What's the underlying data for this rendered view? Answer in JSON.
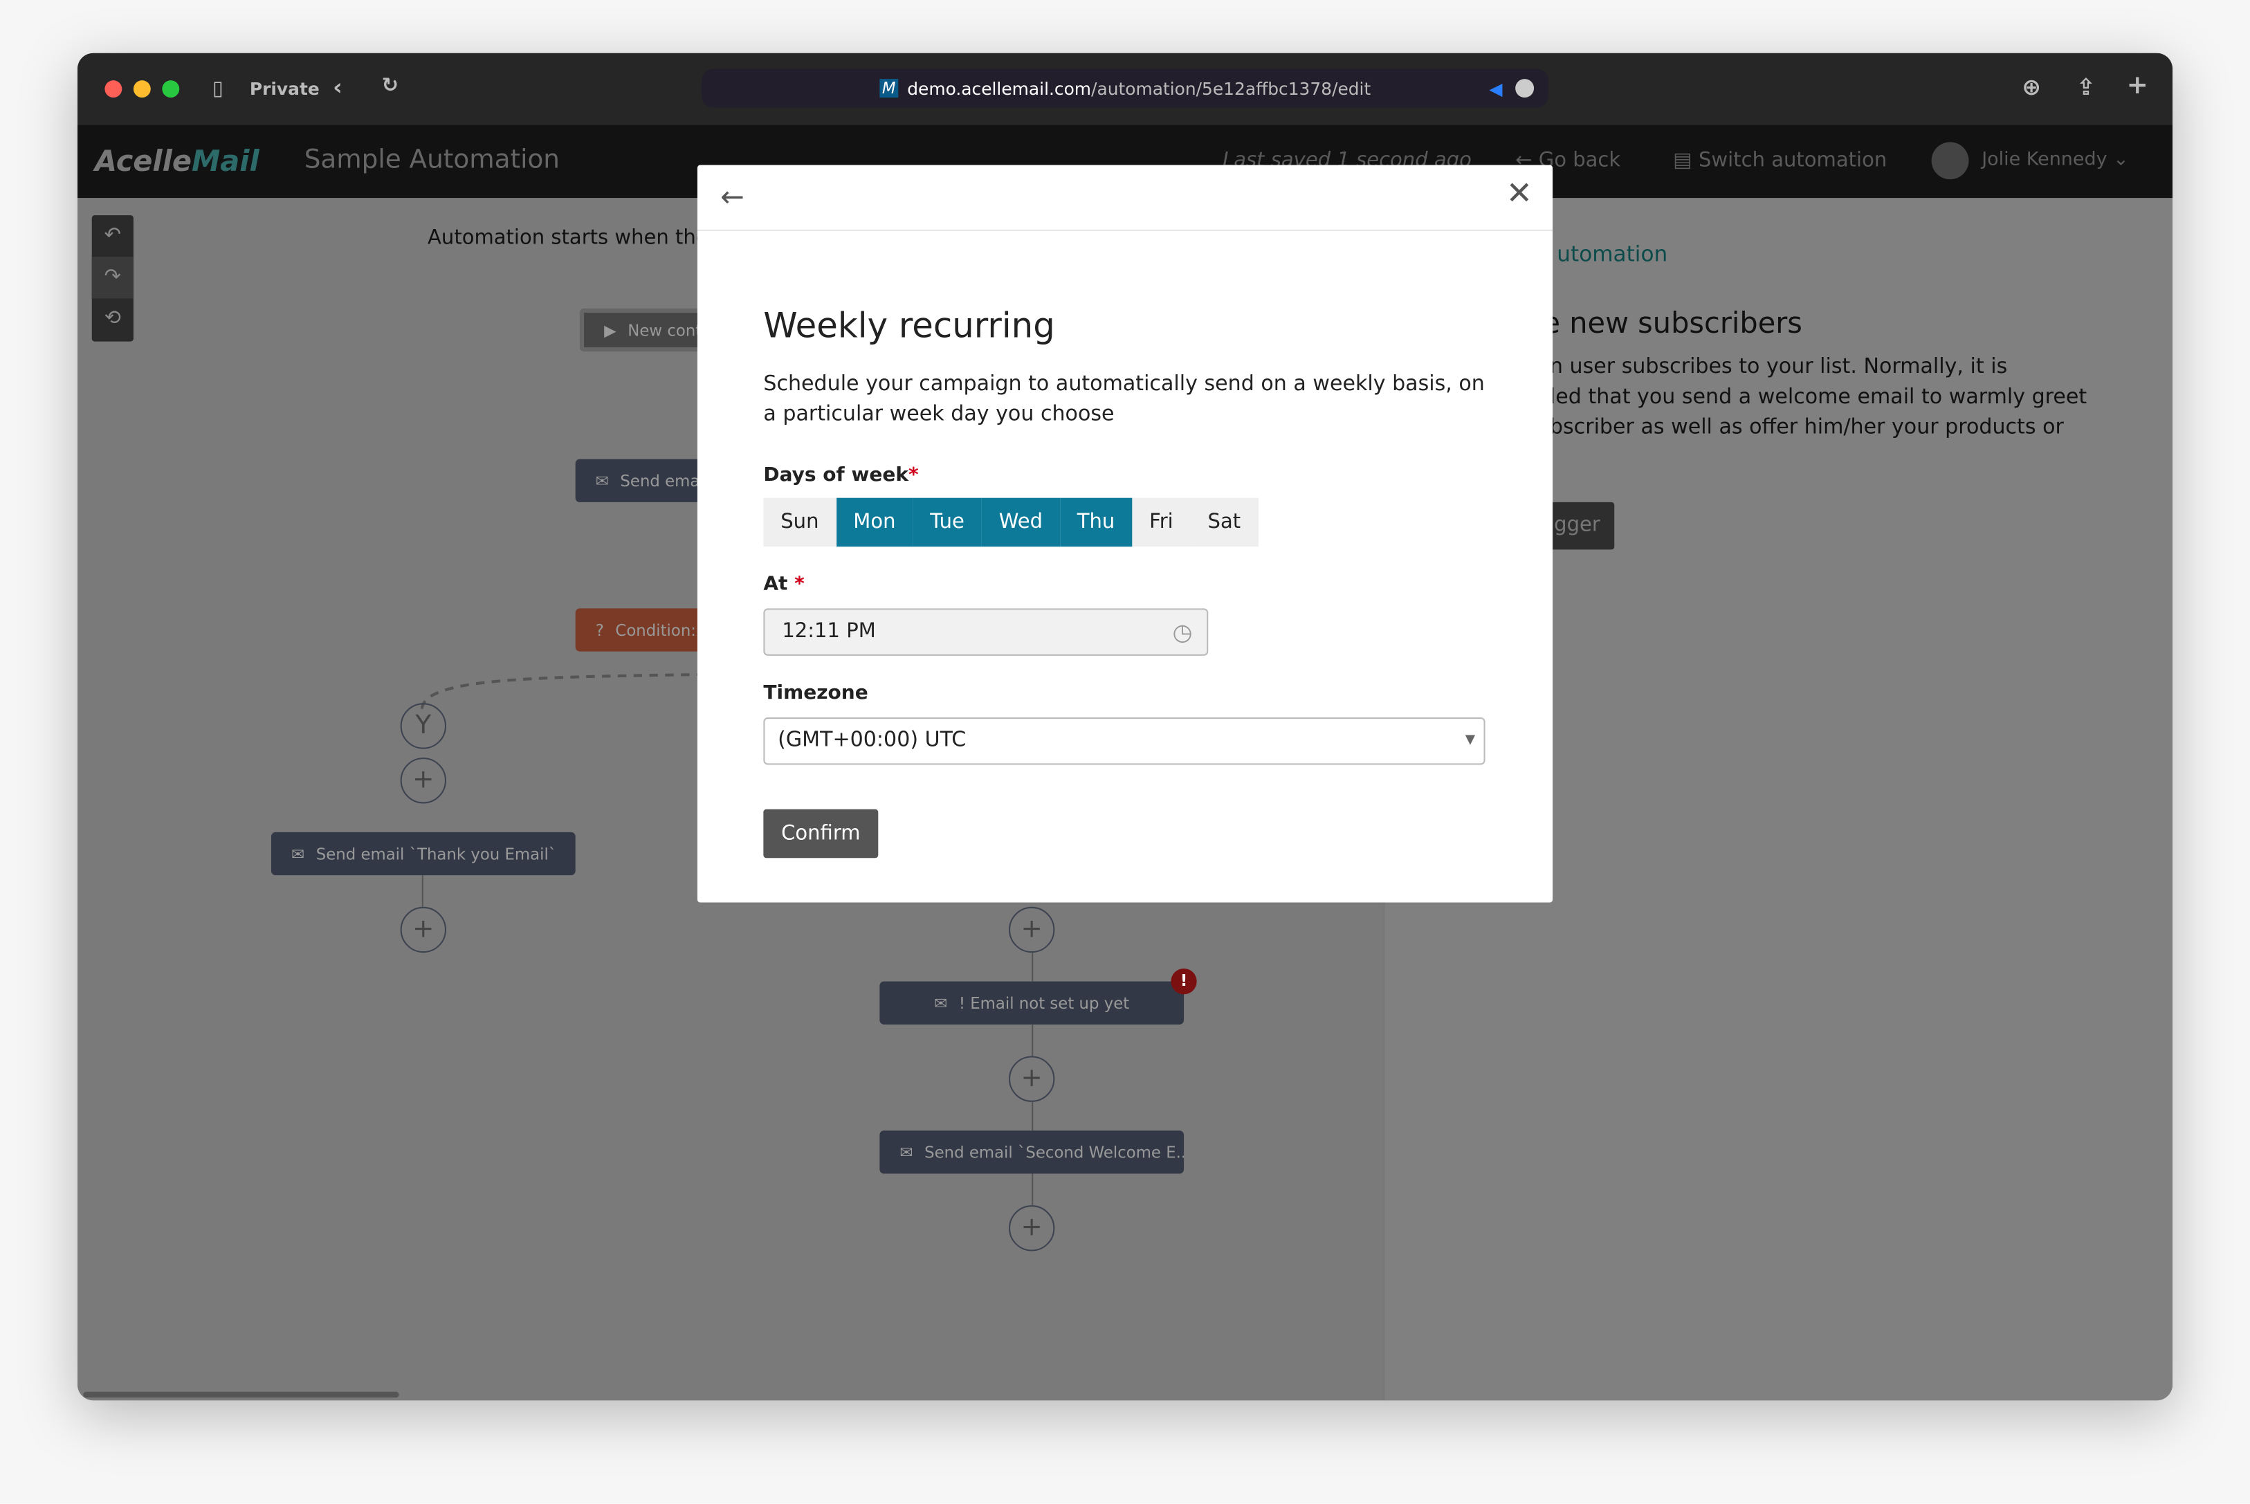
{
  "browser": {
    "mode": "Private",
    "url_domain": "demo.acellemail.com",
    "url_path": "/automation/5e12affbc1378/edit",
    "site_icon": "M"
  },
  "app": {
    "logo_a": "Acelle",
    "logo_b": "Mail",
    "title": "Sample Automation",
    "last_saved": "Last saved 1 second ago",
    "go_back": "Go back",
    "switch": "Switch automation",
    "user": "Jolie Kennedy"
  },
  "canvas": {
    "start_text": "Automation starts when the",
    "nodes": {
      "trigger": "New contact",
      "send1": "Send email",
      "condition": "Condition:",
      "thanks": "Send email `Thank you Email`",
      "not_setup": "! Email not set up yet",
      "second": "Send email `Second Welcome E..."
    },
    "yes": "Y",
    "plus": "+"
  },
  "right_panel": {
    "link": "utomation",
    "heading": "e new subscribers",
    "body": "n user subscribes to your list. Normally, it is\nled that you send a welcome email to warmly greet\nbscriber as well as offer him/her your products or",
    "button": "gger"
  },
  "modal": {
    "title": "Weekly recurring",
    "description": "Schedule your campaign to automatically send on a weekly basis, on a particular week day you choose",
    "days_label": "Days of week",
    "days": [
      {
        "label": "Sun",
        "selected": false
      },
      {
        "label": "Mon",
        "selected": true
      },
      {
        "label": "Tue",
        "selected": true
      },
      {
        "label": "Wed",
        "selected": true
      },
      {
        "label": "Thu",
        "selected": true
      },
      {
        "label": "Fri",
        "selected": false
      },
      {
        "label": "Sat",
        "selected": false
      }
    ],
    "at_label": "At",
    "at_value": "12:11 PM",
    "timezone_label": "Timezone",
    "timezone_value": "(GMT+00:00) UTC",
    "confirm": "Confirm",
    "accent": "#0e7a9a"
  }
}
